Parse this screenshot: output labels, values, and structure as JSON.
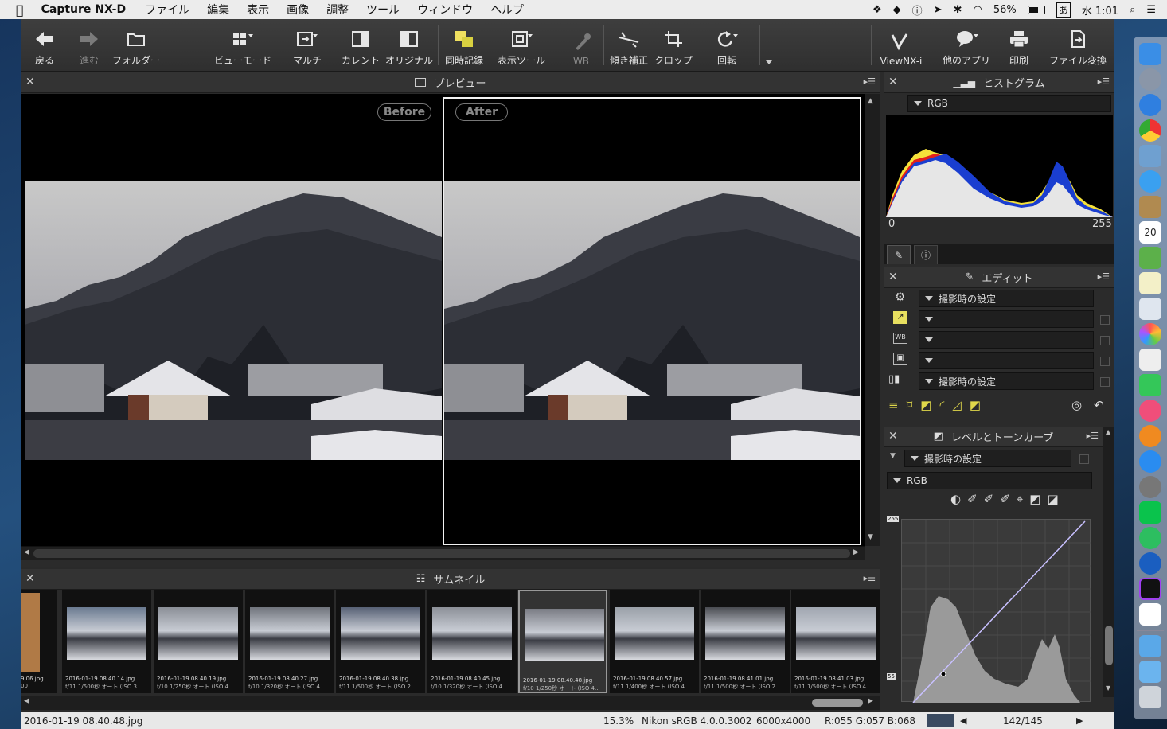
{
  "menubar": {
    "app_name": "Capture NX-D",
    "items": [
      "ファイル",
      "編集",
      "表示",
      "画像",
      "調整",
      "ツール",
      "ウィンドウ",
      "ヘルプ"
    ],
    "battery": "56%",
    "input_method": "あ",
    "clock": "水 1:01"
  },
  "toolbar": {
    "back": "戻る",
    "forward": "進む",
    "folder": "フォルダー",
    "view_mode": "ビューモード",
    "multi": "マルチ",
    "current": "カレント",
    "original": "オリジナル",
    "sync_record": "同時記録",
    "display_tool": "表示ツール",
    "wb": "WB",
    "tilt": "傾き補正",
    "crop": "クロップ",
    "rotate": "回転",
    "viewnx": "ViewNX-i",
    "other_apps": "他のアプリ",
    "print": "印刷",
    "convert": "ファイル変換"
  },
  "preview": {
    "title": "プレビュー",
    "before_label": "Before",
    "after_label": "After"
  },
  "thumbnails": {
    "title": "サムネイル",
    "items": [
      {
        "name": "2016-01-19 08.40.14.jpg",
        "meta": "f/11 1/500秒 オート (ISO 3..."
      },
      {
        "name": "2016-01-19 08.40.19.jpg",
        "meta": "f/10 1/250秒 オート (ISO 4..."
      },
      {
        "name": "2016-01-19 08.40.27.jpg",
        "meta": "f/10 1/320秒 オート (ISO 4..."
      },
      {
        "name": "2016-01-19 08.40.38.jpg",
        "meta": "f/11 1/500秒 オート (ISO 2..."
      },
      {
        "name": "2016-01-19 08.40.45.jpg",
        "meta": "f/10 1/320秒 オート (ISO 4..."
      },
      {
        "name": "2016-01-19 08.40.48.jpg",
        "meta": "f/10 1/250秒 オート (ISO 4..."
      },
      {
        "name": "2016-01-19 08.40.57.jpg",
        "meta": "f/11 1/400秒 オート (ISO 4..."
      },
      {
        "name": "2016-01-19 08.41.01.jpg",
        "meta": "f/11 1/500秒 オート (ISO 2..."
      },
      {
        "name": "2016-01-19 08.41.03.jpg",
        "meta": "f/11 1/500秒 オート (ISO 4..."
      }
    ],
    "partial_name": "9.06.jpg",
    "partial_meta": "00"
  },
  "histogram": {
    "title": "ヒストグラム",
    "channel": "RGB",
    "min_label": "0",
    "max_label": "255"
  },
  "edit": {
    "title": "エディット",
    "rows": [
      "撮影時の設定",
      "",
      "",
      "",
      "撮影時の設定"
    ]
  },
  "levels": {
    "title": "レベルとトーンカーブ",
    "preset": "撮影時の設定",
    "channel": "RGB",
    "top_value": "255",
    "bottom_value": "55"
  },
  "status": {
    "filename": "2016-01-19 08.40.48.jpg",
    "zoom": "15.3%",
    "profile": "Nikon sRGB 4.0.0.3002",
    "dimensions": "6000x4000",
    "rgb": "R:055 G:057 B:068",
    "counter": "142/145"
  }
}
